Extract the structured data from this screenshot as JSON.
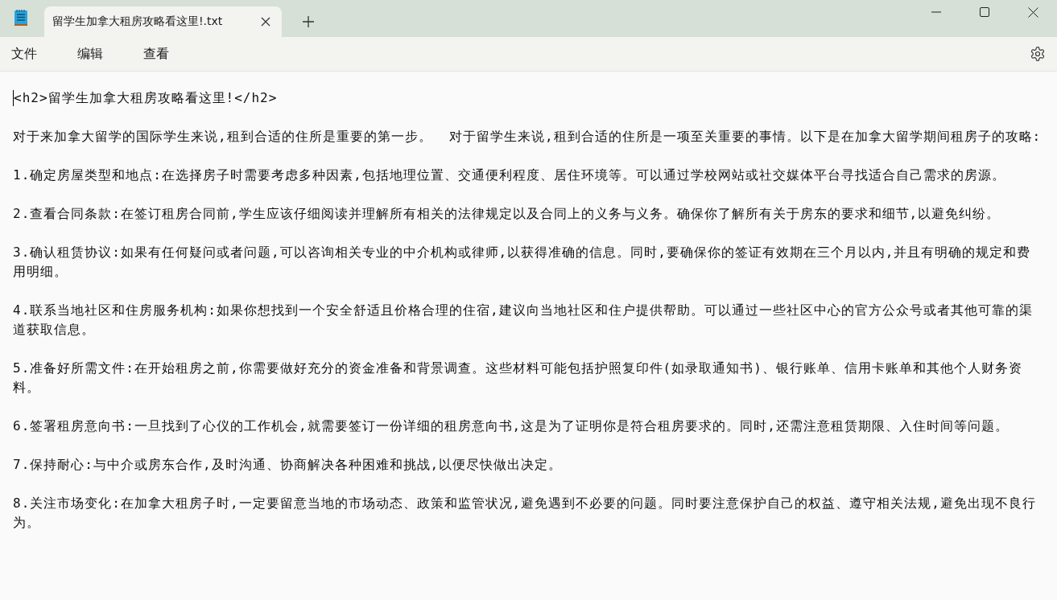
{
  "tabs": [
    {
      "label": "留学生加拿大租房攻略看这里!.txt",
      "selected": true
    }
  ],
  "menu": [
    "文件",
    "编辑",
    "查看"
  ],
  "document": {
    "paragraphs": [
      "<h2>留学生加拿大租房攻略看这里!</h2>",
      "对于来加拿大留学的国际学生来说,租到合适的住所是重要的第一步。  对于留学生来说,租到合适的住所是一项至关重要的事情。以下是在加拿大留学期间租房子的攻略:",
      "1.确定房屋类型和地点:在选择房子时需要考虑多种因素,包括地理位置、交通便利程度、居住环境等。可以通过学校网站或社交媒体平台寻找适合自己需求的房源。",
      "2.查看合同条款:在签订租房合同前,学生应该仔细阅读并理解所有相关的法律规定以及合同上的义务与义务。确保你了解所有关于房东的要求和细节,以避免纠纷。",
      "3.确认租赁协议:如果有任何疑问或者问题,可以咨询相关专业的中介机构或律师,以获得准确的信息。同时,要确保你的签证有效期在三个月以内,并且有明确的规定和费用明细。",
      "4.联系当地社区和住房服务机构:如果你想找到一个安全舒适且价格合理的住宿,建议向当地社区和住户提供帮助。可以通过一些社区中心的官方公众号或者其他可靠的渠道获取信息。",
      "5.准备好所需文件:在开始租房之前,你需要做好充分的资金准备和背景调查。这些材料可能包括护照复印件(如录取通知书)、银行账单、信用卡账单和其他个人财务资料。",
      "6.签署租房意向书:一旦找到了心仪的工作机会,就需要签订一份详细的租房意向书,这是为了证明你是符合租房要求的。同时,还需注意租赁期限、入住时间等问题。",
      "7.保持耐心:与中介或房东合作,及时沟通、协商解决各种困难和挑战,以便尽快做出决定。",
      "8.关注市场变化:在加拿大租房子时,一定要留意当地的市场动态、政策和监管状况,避免遇到不必要的问题。同时要注意保护自己的权益、遵守相关法规,避免出现不良行为。"
    ]
  }
}
